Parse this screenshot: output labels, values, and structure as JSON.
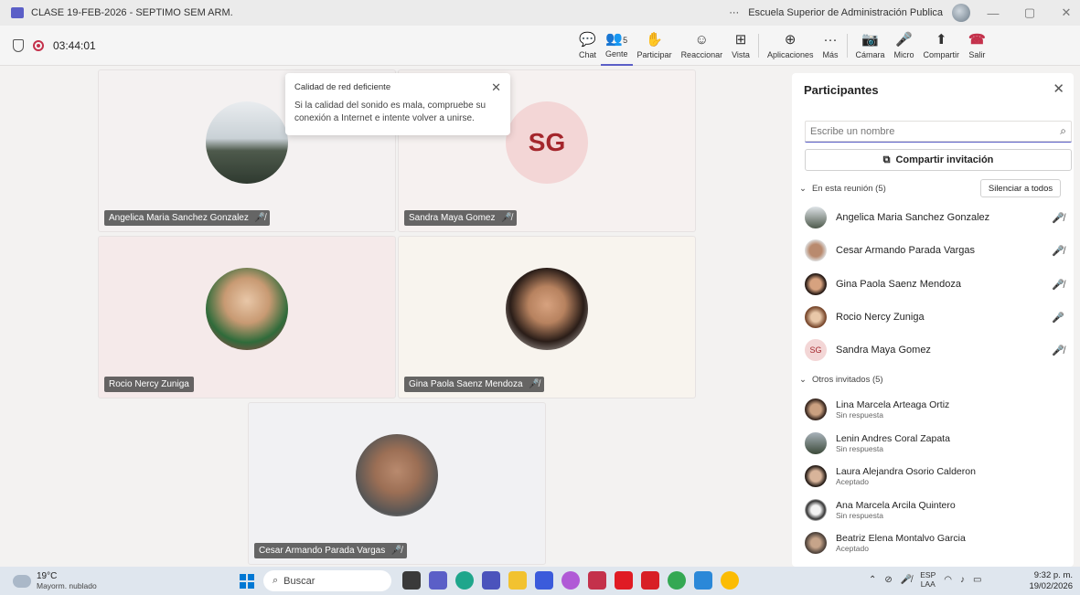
{
  "window": {
    "title": "CLASE 19-FEB-2026 - SEPTIMO SEM ARM.",
    "more": "···",
    "org": "Escuela Superior de Administración Publica",
    "minimize": "—",
    "restore": "▢",
    "close": "✕"
  },
  "meeting": {
    "timer": "03:44:01",
    "people_count": "5",
    "tools": [
      {
        "icon": "chat-icon",
        "glyph": "💬",
        "label": "Chat"
      },
      {
        "icon": "people-icon",
        "glyph": "👥",
        "label": "Gente"
      },
      {
        "icon": "raise-hand-icon",
        "glyph": "✋",
        "label": "Participar"
      },
      {
        "icon": "react-icon",
        "glyph": "☺",
        "label": "Reaccionar"
      },
      {
        "icon": "view-icon",
        "glyph": "⊞",
        "label": "Vista"
      },
      {
        "icon": "apps-icon",
        "glyph": "⊕",
        "label": "Aplicaciones"
      },
      {
        "icon": "more-icon",
        "glyph": "···",
        "label": "Más"
      },
      {
        "icon": "camera-off-icon",
        "glyph": "📷",
        "label": "Cámara"
      },
      {
        "icon": "mic-off-icon",
        "glyph": "🎤",
        "label": "Micro"
      },
      {
        "icon": "share-icon",
        "glyph": "⬆",
        "label": "Compartir"
      },
      {
        "icon": "leave-icon",
        "glyph": "☎",
        "label": "Salir"
      }
    ]
  },
  "toast": {
    "title": "Calidad de red deficiente",
    "body": "Si la calidad del sonido es mala, compruebe su conexión a Internet e intente volver a unirse.",
    "close": "✕"
  },
  "tiles": [
    {
      "name": "Angelica Maria Sanchez Gonzalez",
      "muted": true
    },
    {
      "name": "Sandra Maya Gomez",
      "initials": "SG",
      "muted": true
    },
    {
      "name": "Rocio Nercy Zuniga",
      "muted": false
    },
    {
      "name": "Gina Paola Saenz Mendoza",
      "muted": true
    },
    {
      "name": "Cesar Armando Parada Vargas",
      "muted": true
    }
  ],
  "panel": {
    "title": "Participantes",
    "close": "✕",
    "search_placeholder": "Escribe un nombre",
    "invite_label": "Compartir invitación",
    "in_meeting_label": "En esta reunión (5)",
    "mute_all": "Silenciar a todos",
    "in_meeting": [
      {
        "name": "Angelica Maria Sanchez Gonzalez",
        "mic": "muted"
      },
      {
        "name": "Cesar Armando Parada Vargas",
        "mic": "muted"
      },
      {
        "name": "Gina Paola Saenz Mendoza",
        "mic": "muted"
      },
      {
        "name": "Rocio Nercy Zuniga",
        "mic": "on"
      },
      {
        "name": "Sandra Maya Gomez",
        "initials": "SG",
        "mic": "muted"
      }
    ],
    "others_label": "Otros invitados (5)",
    "others": [
      {
        "name": "Lina Marcela Arteaga Ortiz",
        "status": "Sin respuesta"
      },
      {
        "name": "Lenin Andres Coral Zapata",
        "status": "Sin respuesta"
      },
      {
        "name": "Laura Alejandra Osorio Calderon",
        "status": "Aceptado"
      },
      {
        "name": "Ana Marcela Arcila Quintero",
        "status": "Sin respuesta"
      },
      {
        "name": "Beatriz Elena Montalvo Garcia",
        "status": "Aceptado"
      }
    ]
  },
  "taskbar": {
    "temperature": "19°C",
    "weather": "Mayorm. nublado",
    "search": "Buscar",
    "lang_top": "ESP",
    "lang_bottom": "LAA",
    "time": "9:32 p. m.",
    "date": "19/02/2026"
  }
}
